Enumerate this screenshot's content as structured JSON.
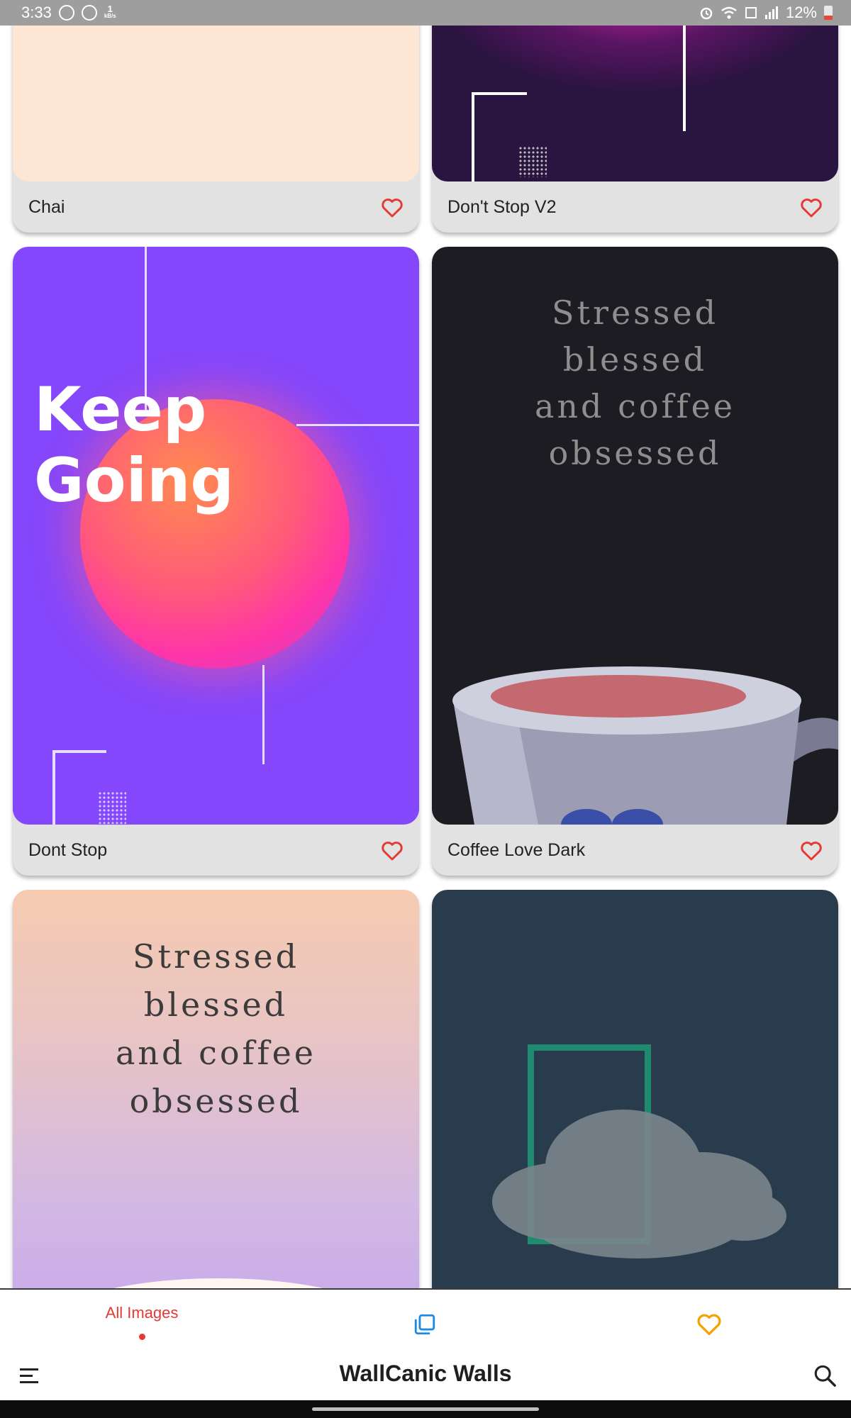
{
  "status_bar": {
    "time": "3:33",
    "net_speed_value": "1",
    "net_speed_unit": "kB/s",
    "battery": "12%"
  },
  "wallpapers": [
    {
      "title": "Chai",
      "favorite": false
    },
    {
      "title": "Don't Stop V2",
      "favorite": false
    },
    {
      "title": "Dont Stop",
      "favorite": false,
      "image_text": [
        "Keep",
        "Going"
      ]
    },
    {
      "title": "Coffee Love Dark",
      "favorite": false,
      "image_text": [
        "Stressed",
        "blessed",
        "and coffee",
        "obsessed"
      ]
    },
    {
      "title": "",
      "image_text": [
        "Stressed",
        "blessed",
        "and coffee",
        "obsessed"
      ]
    },
    {
      "title": ""
    }
  ],
  "bottom_nav": {
    "tabs": [
      {
        "label": "All Images",
        "active": true,
        "icon": "dot-indicator"
      },
      {
        "label": "",
        "icon": "collections-icon"
      },
      {
        "label": "",
        "icon": "heart-icon"
      }
    ]
  },
  "toolbar": {
    "title": "WallCanic Walls",
    "menu_icon": "menu-icon",
    "search_icon": "search-icon"
  },
  "colors": {
    "accent": "#e53935",
    "collections_icon": "#1e88e5",
    "favorites_icon": "#f4a300"
  }
}
